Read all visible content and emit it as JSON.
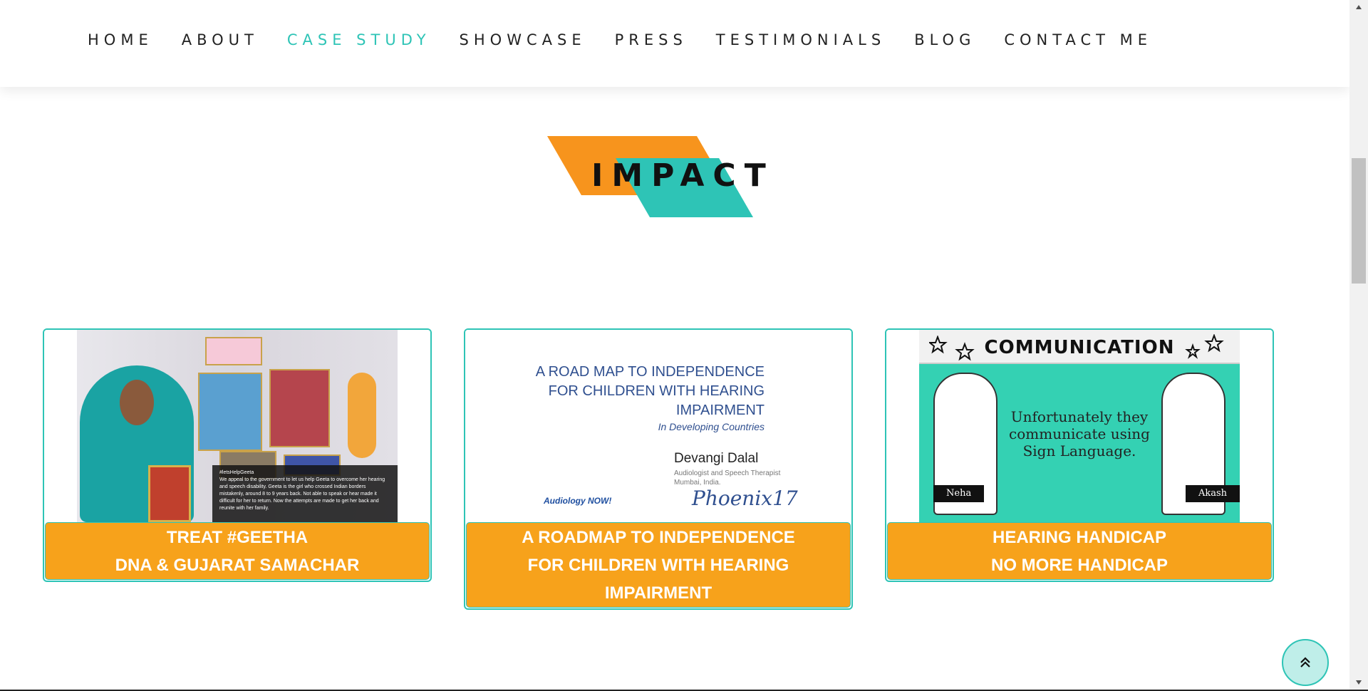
{
  "nav": {
    "items": [
      {
        "label": "HOME"
      },
      {
        "label": "ABOUT"
      },
      {
        "label": "CASE STUDY",
        "active": true
      },
      {
        "label": "SHOWCASE"
      },
      {
        "label": "PRESS"
      },
      {
        "label": "TESTIMONIALS"
      },
      {
        "label": "BLOG"
      },
      {
        "label": "CONTACT ME"
      }
    ]
  },
  "section": {
    "title": "IMPACT"
  },
  "cards": [
    {
      "caption_line1": "TREAT #GEETHA",
      "caption_line2": "DNA & GUJARAT SAMACHAR",
      "image": {
        "overlay_hashtag": "#letsHelpGeeta",
        "overlay_text": "We appeal to the government to let us help Geeta to overcome her hearing and speech disability. Geeta is the girl who crossed Indian borders mistakenly, around 8 to 9 years back. Not able to speak or hear made it difficult for her to return. Now the attempts are made to get her back and reunite with her family."
      }
    },
    {
      "caption_line1": "A ROADMAP TO INDEPENDENCE",
      "caption_line2": "FOR CHILDREN WITH HEARING",
      "caption_line3": "IMPAIRMENT",
      "image": {
        "title_line1": "A ROAD MAP TO INDEPENDENCE",
        "title_line2": "FOR CHILDREN WITH HEARING",
        "title_line3": "IMPAIRMENT",
        "subtitle": "In Developing Countries",
        "author": "Devangi Dalal",
        "role_line1": "Audiologist and Speech Therapist",
        "role_line2": "Mumbai, India.",
        "logo_left": "Audiology NOW!",
        "logo_right": "Phoenix17"
      }
    },
    {
      "caption_line1": "HEARING HANDICAP",
      "caption_line2": "NO MORE HANDICAP",
      "image": {
        "banner": "COMMUNICATION",
        "text": "Unfortunately they communicate using Sign Language.",
        "left_name": "Neha",
        "right_name": "Akash"
      }
    }
  ],
  "colors": {
    "accent_teal": "#2ec4b6",
    "accent_orange": "#f7941d",
    "caption_orange": "#f7a21b"
  },
  "icons": {
    "scroll_top": "double-chevron-up-icon"
  }
}
